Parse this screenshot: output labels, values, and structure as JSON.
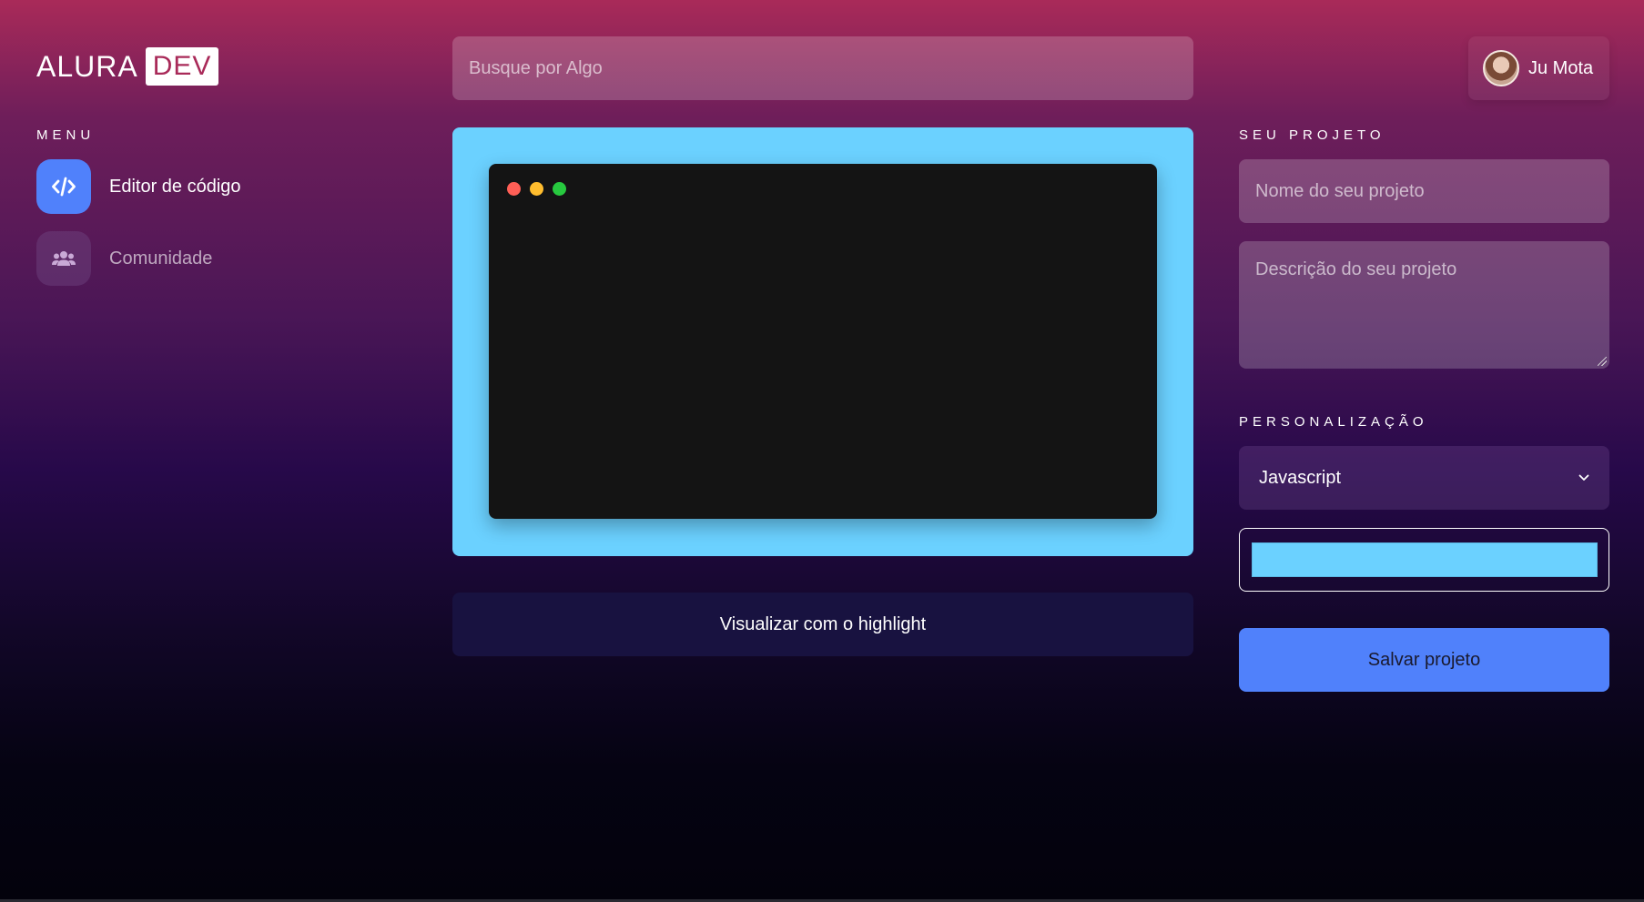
{
  "logo": {
    "alura": "ALURA",
    "dev": "DEV"
  },
  "search": {
    "placeholder": "Busque por Algo"
  },
  "user": {
    "name": "Ju Mota"
  },
  "menu": {
    "title": "MENU",
    "items": [
      {
        "label": "Editor de código",
        "icon": "code-icon",
        "active": true
      },
      {
        "label": "Comunidade",
        "icon": "users-icon",
        "active": false
      }
    ]
  },
  "editor": {
    "frame_color": "#6bd1ff",
    "dots": [
      "#ff5f56",
      "#ffbd2e",
      "#27c93f"
    ]
  },
  "highlight_button": {
    "label": "Visualizar com o highlight"
  },
  "project": {
    "title": "SEU PROJETO",
    "name_placeholder": "Nome do seu projeto",
    "description_placeholder": "Descrição do seu projeto"
  },
  "customization": {
    "title": "PERSONALIZAÇÃO",
    "language_selected": "Javascript",
    "color": "#6bd1ff"
  },
  "save_button": {
    "label": "Salvar projeto"
  },
  "colors": {
    "accent": "#5081fb",
    "editor_bg": "#141414"
  }
}
